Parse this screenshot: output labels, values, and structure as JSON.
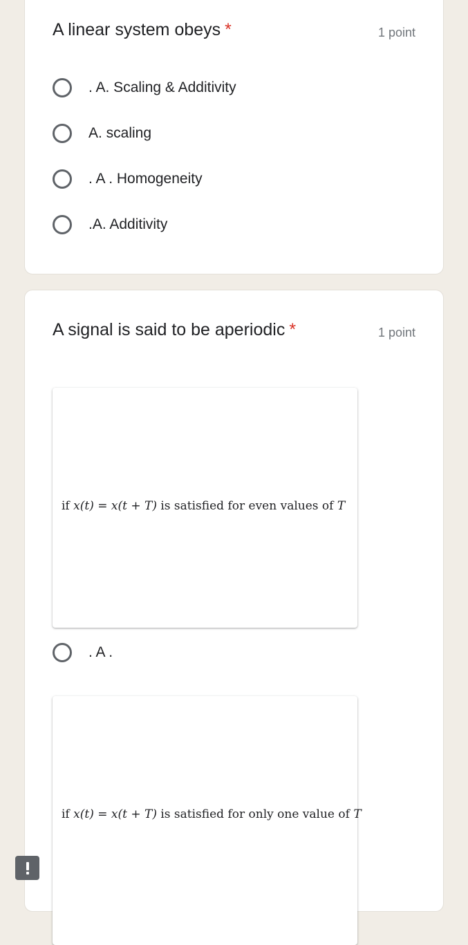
{
  "question1": {
    "title": "A linear system obeys",
    "required_marker": "*",
    "points": "1 point",
    "options": [
      {
        "label": ". A. Scaling & Additivity"
      },
      {
        "label": "A. scaling"
      },
      {
        "label": ". A . Homogeneity"
      },
      {
        "label": ".A. Additivity"
      }
    ]
  },
  "question2": {
    "title": "A signal is said to be aperiodic",
    "required_marker": "*",
    "points": "1 point",
    "image1_text": {
      "prefix": "if ",
      "formula_lhs": "x(t) = x(t + T)",
      "suffix": " is satisfied for even values of ",
      "var": "T"
    },
    "option1_label": ". A .",
    "image2_text": {
      "prefix": "if ",
      "formula_lhs": "x(t) = x(t + T)",
      "suffix": " is satisfied for only one value of ",
      "var": "T"
    }
  },
  "colors": {
    "background": "#f1ede6",
    "card": "#ffffff",
    "required": "#d93025",
    "radio_border": "#5f6368",
    "points_text": "#70757a"
  },
  "icons": {
    "feedback": "report-exclamation-icon"
  }
}
